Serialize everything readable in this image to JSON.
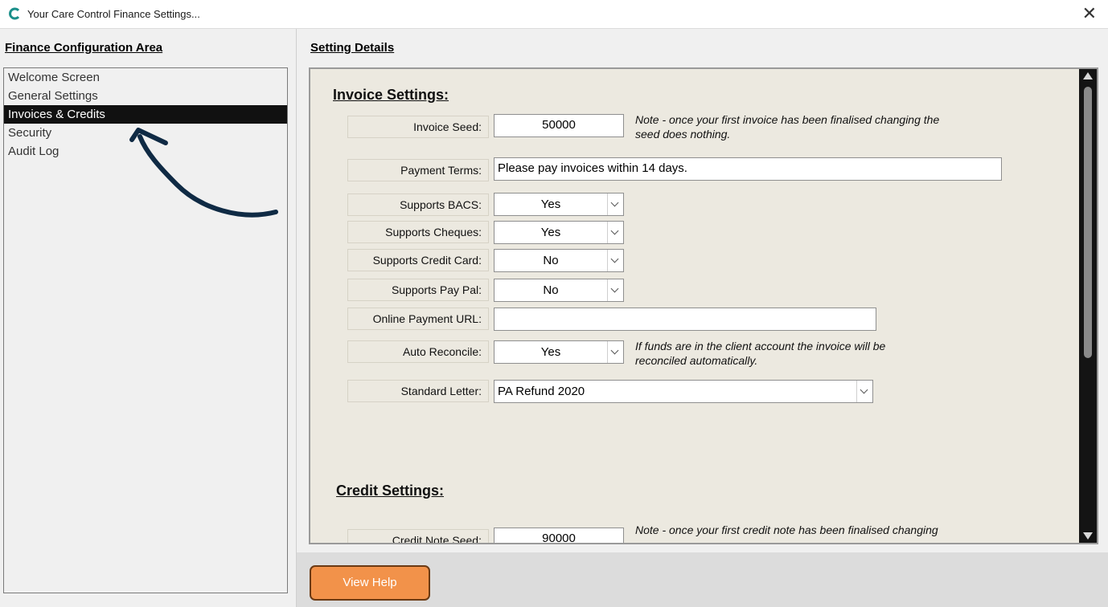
{
  "window": {
    "title": "Your Care Control Finance Settings...",
    "close_glyph": "✕"
  },
  "left": {
    "heading": "Finance Configuration Area",
    "items": [
      {
        "label": "Welcome Screen"
      },
      {
        "label": "General Settings"
      },
      {
        "label": "Invoices & Credits",
        "selected": true
      },
      {
        "label": "Security"
      },
      {
        "label": "Audit Log"
      }
    ]
  },
  "details": {
    "heading": "Setting Details",
    "invoice": {
      "heading": "Invoice Settings:",
      "seed_label": "Invoice Seed:",
      "seed_value": "50000",
      "seed_note_1": "Note - once your first invoice has been finalised changing the",
      "seed_note_2": "seed does nothing.",
      "terms_label": "Payment Terms:",
      "terms_value": "Please pay invoices within 14 days.",
      "bacs_label": "Supports BACS:",
      "bacs_value": "Yes",
      "cheques_label": "Supports Cheques:",
      "cheques_value": "Yes",
      "card_label": "Supports Credit Card:",
      "card_value": "No",
      "paypal_label": "Supports Pay Pal:",
      "paypal_value": "No",
      "url_label": "Online Payment URL:",
      "url_value": "",
      "reconcile_label": "Auto Reconcile:",
      "reconcile_value": "Yes",
      "reconcile_note_1": "If funds are in the client account the invoice will be",
      "reconcile_note_2": "reconciled automatically.",
      "letter_label": "Standard Letter:",
      "letter_value": "PA Refund 2020"
    },
    "credit": {
      "heading": "Credit Settings:",
      "seed_label": "Credit Note Seed:",
      "seed_value": "90000",
      "seed_note_1": "Note - once your first credit note has been finalised changing"
    }
  },
  "footer": {
    "help_label": "View Help"
  },
  "colors": {
    "accent_button": "#f2924a",
    "selection": "#111111",
    "panel": "#ece9e0",
    "annotation_arrow": "#0f2a44"
  }
}
